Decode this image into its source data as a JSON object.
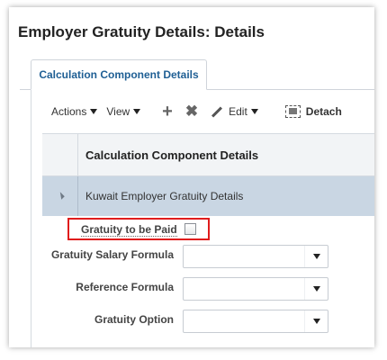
{
  "page": {
    "title": "Employer Gratuity Details: Details"
  },
  "tabs": [
    {
      "label": "Calculation Component Details"
    }
  ],
  "toolbar": {
    "actions_label": "Actions",
    "view_label": "View",
    "add_icon": "+",
    "delete_icon": "✖",
    "edit_label": "Edit",
    "detach_label": "Detach"
  },
  "table": {
    "header": "Calculation Component Details",
    "rows": [
      {
        "label": "Kuwait Employer Gratuity Details"
      }
    ]
  },
  "form": {
    "gratuity_to_be_paid_label": "Gratuity to be Paid",
    "gratuity_to_be_paid_checked": false,
    "fields": [
      {
        "label": "Gratuity Salary Formula",
        "value": ""
      },
      {
        "label": "Reference Formula",
        "value": ""
      },
      {
        "label": "Gratuity Option",
        "value": ""
      }
    ]
  },
  "colors": {
    "highlight": "#e01c1c",
    "selected_row": "#c9d6e3",
    "tab_text": "#1f5f94"
  }
}
